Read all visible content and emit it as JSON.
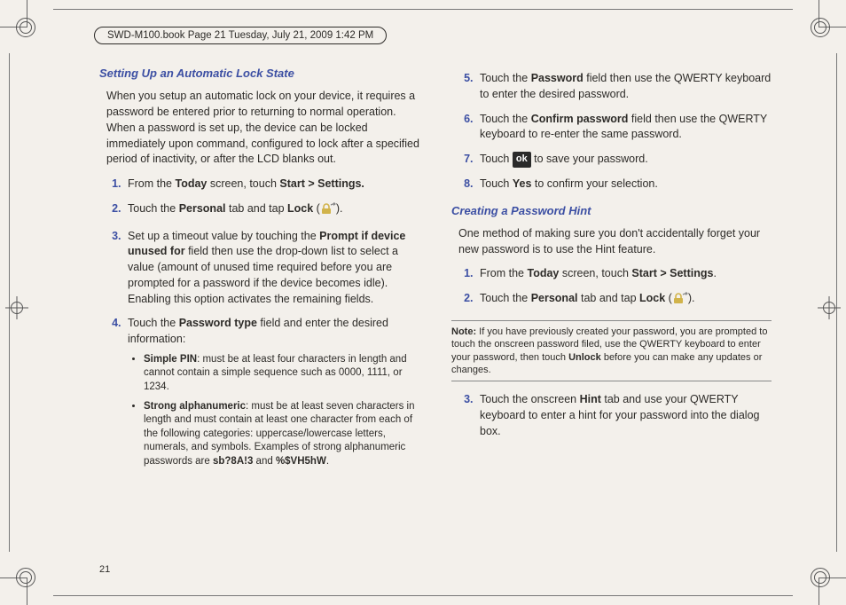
{
  "running_header": "SWD-M100.book  Page 21  Tuesday, July 21, 2009  1:42 PM",
  "page_number": "21",
  "left": {
    "title": "Setting Up an Automatic Lock State",
    "intro": "When you setup an automatic lock on your device, it requires a password be entered prior to returning to normal operation. When a password is set up, the device can be locked immediately upon command, configured to lock after a specified period of inactivity, or after the LCD blanks out.",
    "step1_a": "From the ",
    "step1_b": "Today",
    "step1_c": " screen, touch ",
    "step1_d": "Start > Settings.",
    "step2_a": "Touch the ",
    "step2_b": "Personal",
    "step2_c": " tab and tap ",
    "step2_d": "Lock",
    "step2_e": " (",
    "step2_f": ").",
    "step3_a": "Set up a timeout value by touching the ",
    "step3_b": "Prompt if device unused for",
    "step3_c": " field then use the drop-down list to select a value (amount of unused time required before you are prompted for a password if the device becomes idle). Enabling this option activates the remaining fields.",
    "step4_a": "Touch the ",
    "step4_b": "Password type",
    "step4_c": " field and enter the desired information:",
    "pin_a": "Simple PIN",
    "pin_b": ": must be at least four characters in length and cannot contain a simple sequence such as 0000, 1111, or 1234.",
    "alnum_a": "Strong alphanumeric",
    "alnum_b": ": must be at least seven characters in length and must contain at least one character from each of the following categories: uppercase/lowercase letters, numerals, and symbols. Examples of strong alphanumeric passwords are ",
    "alnum_c": "sb?8A!3",
    "alnum_d": " and ",
    "alnum_e": "%$VH5hW",
    "alnum_f": "."
  },
  "right": {
    "step5_a": "Touch the ",
    "step5_b": "Password",
    "step5_c": " field then use the QWERTY keyboard to enter the desired password.",
    "step6_a": "Touch the ",
    "step6_b": "Confirm password",
    "step6_c": " field then use the QWERTY keyboard to re-enter the same password.",
    "step7_a": "Touch ",
    "step7_ok": "ok",
    "step7_b": " to save your password.",
    "step8_a": "Touch ",
    "step8_b": "Yes",
    "step8_c": " to confirm your selection.",
    "title2": "Creating a Password Hint",
    "intro2": "One method of making sure you don't accidentally forget your new password is to use the Hint feature.",
    "h_step1_a": "From the ",
    "h_step1_b": "Today",
    "h_step1_c": " screen, touch ",
    "h_step1_d": "Start > Settings",
    "h_step1_e": ".",
    "h_step2_a": "Touch the ",
    "h_step2_b": "Personal",
    "h_step2_c": " tab and tap ",
    "h_step2_d": "Lock",
    "h_step2_e": " (",
    "h_step2_f": ").",
    "note_lbl": "Note:",
    "note_a": " If you have previously created your password, you are prompted to touch the onscreen password filed, use the QWERTY keyboard to enter your password, then touch ",
    "note_b": "Unlock",
    "note_c": " before you can make any updates or changes.",
    "h_step3_a": "Touch the onscreen ",
    "h_step3_b": "Hint",
    "h_step3_c": " tab and use your QWERTY keyboard to enter a hint for your password into the dialog box."
  }
}
